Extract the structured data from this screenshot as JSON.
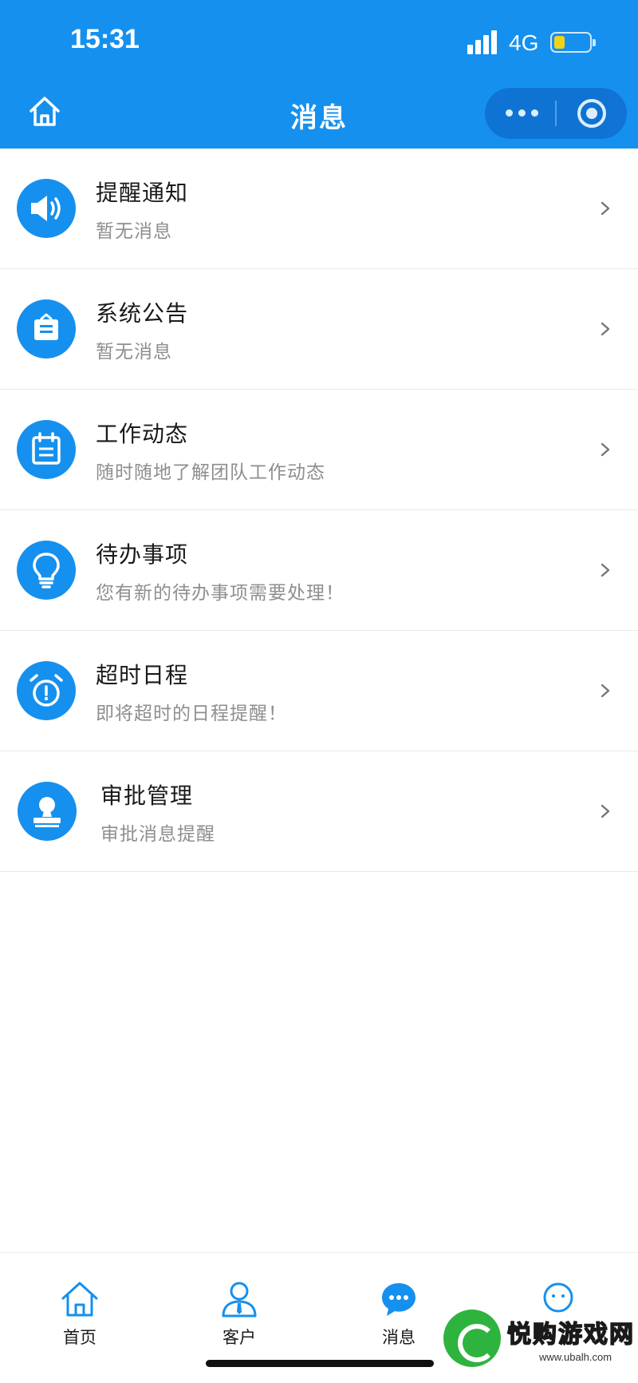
{
  "status_bar": {
    "time": "15:31",
    "network": "4G",
    "battery_level": 0.3
  },
  "header": {
    "title": "消息",
    "home_icon": "home-icon",
    "more_icon": "more-dots-icon",
    "close_icon": "target-close-icon"
  },
  "colors": {
    "brand": "#1590ee",
    "title_text": "#1a1a1a",
    "subtitle_text": "#8e8e8e",
    "battery": "#ffd60a"
  },
  "messages": [
    {
      "title": "提醒通知",
      "subtitle": "暂无消息",
      "icon": "speaker-icon"
    },
    {
      "title": "系统公告",
      "subtitle": "暂无消息",
      "icon": "bulletin-bag-icon"
    },
    {
      "title": "工作动态",
      "subtitle": "随时随地了解团队工作动态",
      "icon": "calendar-icon"
    },
    {
      "title": "待办事项",
      "subtitle": "您有新的待办事项需要处理！",
      "icon": "lightbulb-icon"
    },
    {
      "title": "超时日程",
      "subtitle": "即将超时的日程提醒！",
      "icon": "alarm-clock-icon"
    },
    {
      "title": "审批管理",
      "subtitle": "审批消息提醒",
      "icon": "stamp-icon"
    }
  ],
  "tabbar": {
    "items": [
      {
        "label": "首页",
        "icon": "home-tab-icon"
      },
      {
        "label": "客户",
        "icon": "customer-tab-icon"
      },
      {
        "label": "消息",
        "icon": "message-tab-icon"
      },
      {
        "label": "",
        "icon": "profile-tab-icon"
      }
    ]
  },
  "watermark": {
    "text": "悦购游戏网",
    "url": "www.ubalh.com"
  }
}
